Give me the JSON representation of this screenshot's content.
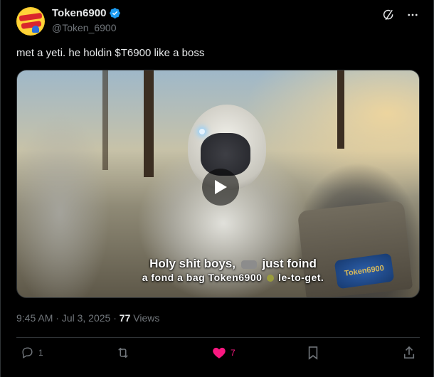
{
  "author": {
    "display_name": "Token6900",
    "handle": "@Token_6900",
    "avatar_icon": "token6900-logo-avatar",
    "verified": true,
    "verified_color": "#1d9bf0"
  },
  "tweet": {
    "text": "met a yeti. he holdin $T6900 like a boss"
  },
  "media": {
    "type": "video",
    "caption_line1_a": "Holy shit boys,",
    "caption_line1_b": "just foind",
    "caption_line2_a": "a fond a bag Token6900",
    "caption_line2_b": "le-to-get.",
    "bag_print": "Token6900",
    "play_icon": "play-icon"
  },
  "meta": {
    "time": "9:45 AM",
    "sep1": " · ",
    "date": "Jul 3, 2025",
    "sep2": " · ",
    "views_count": "77",
    "views_label": " Views"
  },
  "actions": {
    "replies": "1",
    "reposts": "",
    "likes": "7",
    "like_color": "#f91880"
  },
  "colors": {
    "background": "#000000",
    "text_primary": "#e7e9ea",
    "text_secondary": "#71767b",
    "border": "#2f3336"
  }
}
